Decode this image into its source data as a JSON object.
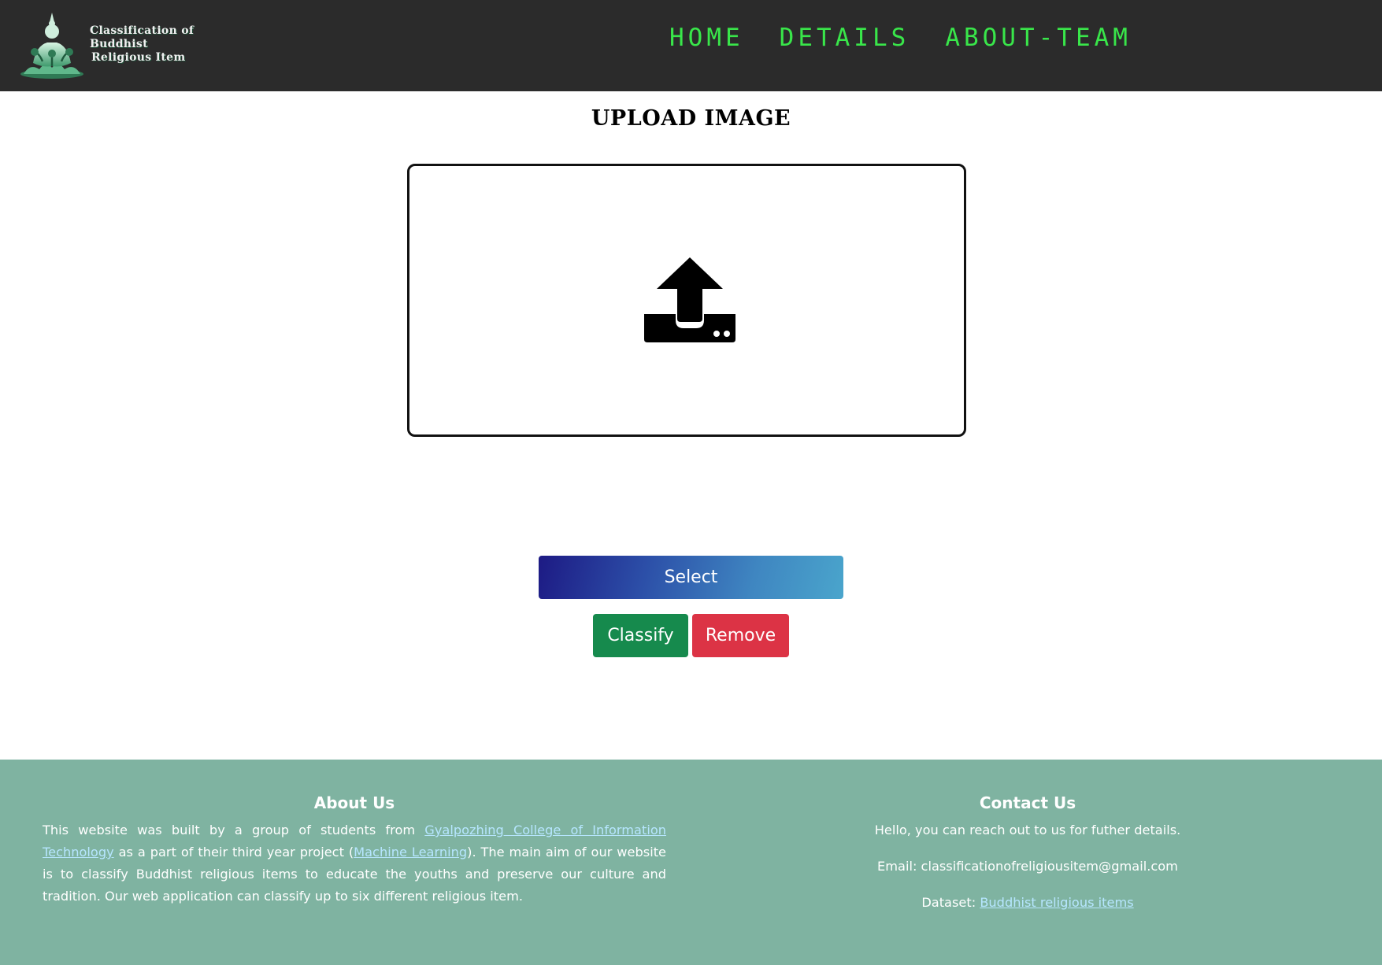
{
  "header": {
    "logo": {
      "title_line1": "Classification of Buddhist",
      "title_line2": "Religious Item"
    },
    "nav": [
      {
        "label": "HOME"
      },
      {
        "label": "DETAILS"
      },
      {
        "label": "ABOUT-TEAM"
      }
    ],
    "colors": {
      "background": "#2b2b2b",
      "nav_text": "#39e64a"
    }
  },
  "main": {
    "title": "UPLOAD IMAGE",
    "dropzone_icon": "upload-tray-icon",
    "buttons": {
      "select": "Select",
      "classify": "Classify",
      "remove": "Remove"
    },
    "colors": {
      "classify": "#168a4d",
      "remove": "#dc3345",
      "select_from": "#1d1a84",
      "select_to": "#4aa5cc"
    }
  },
  "footer": {
    "background": "#7fb3a1",
    "about": {
      "heading": "About Us",
      "text_1": "This website was built by a group of students from ",
      "link_college": "Gyalpozhing College of Information Technology",
      "text_2": " as a part of their third year project (",
      "link_ml": "Machine Learning",
      "text_3": "). The main aim of our website is to classify Buddhist religious items to educate the youths and preserve our culture and tradition. Our web application can classify up to six different religious item."
    },
    "contact": {
      "heading": "Contact Us",
      "intro": "Hello, you can reach out to us for futher details.",
      "email": "Email: classificationofreligiousitem@gmail.com",
      "dataset_label": "Dataset: ",
      "dataset_link": "Buddhist religious items"
    }
  }
}
